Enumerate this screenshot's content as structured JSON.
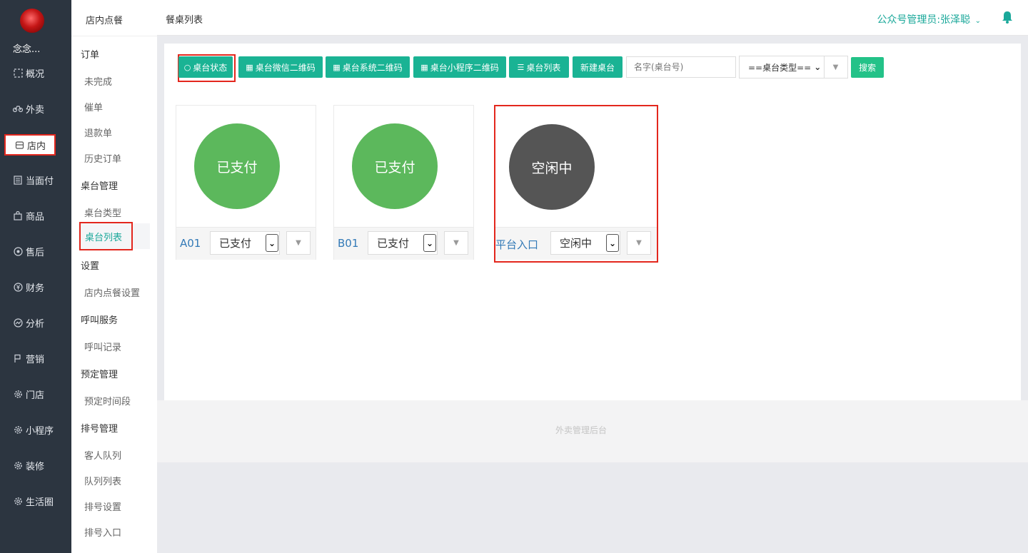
{
  "user": {
    "name": "念念..."
  },
  "nav": [
    {
      "label": "概况",
      "icon": "layout-icon"
    },
    {
      "label": "外卖",
      "icon": "bike-icon"
    },
    {
      "label": "店内",
      "icon": "store-icon",
      "active": true
    },
    {
      "label": "当面付",
      "icon": "receipt-icon"
    },
    {
      "label": "商品",
      "icon": "bag-icon"
    },
    {
      "label": "售后",
      "icon": "service-icon"
    },
    {
      "label": "财务",
      "icon": "yen-icon"
    },
    {
      "label": "分析",
      "icon": "chart-icon"
    },
    {
      "label": "营销",
      "icon": "flag-icon"
    },
    {
      "label": "门店",
      "icon": "gear-icon"
    },
    {
      "label": "小程序",
      "icon": "gear-icon"
    },
    {
      "label": "装修",
      "icon": "gear-icon"
    },
    {
      "label": "生活圈",
      "icon": "gear-icon"
    }
  ],
  "sidebar": {
    "title": "店内点餐",
    "groups": [
      {
        "label": "订单",
        "links": [
          "未完成",
          "催单",
          "退款单",
          "历史订单"
        ]
      },
      {
        "label": "桌台管理",
        "links": [
          "桌台类型",
          "桌台列表"
        ]
      },
      {
        "label": "设置",
        "links": [
          "店内点餐设置"
        ]
      },
      {
        "label": "呼叫服务",
        "links": [
          "呼叫记录"
        ]
      },
      {
        "label": "预定管理",
        "links": [
          "预定时间段"
        ]
      },
      {
        "label": "排号管理",
        "links": [
          "客人队列",
          "队列列表",
          "排号设置",
          "排号入口"
        ]
      }
    ],
    "active_link": "桌台列表"
  },
  "header": {
    "title": "餐桌列表",
    "admin": "公众号管理员:张泽聪",
    "admin_chevron": "chevron-down-icon",
    "bell": "bell-icon"
  },
  "toolbar": {
    "buttons": [
      "桌台状态",
      "桌台微信二维码",
      "桌台系统二维码",
      "桌台小程序二维码",
      "桌台列表",
      "新建桌台"
    ],
    "search_placeholder": "名字(桌台号)",
    "type_select": "==桌台类型==",
    "search_button": "搜索"
  },
  "tables": [
    {
      "name": "A01",
      "status": "已支付",
      "color": "#5cb85c"
    },
    {
      "name": "B01",
      "status": "已支付",
      "color": "#5cb85c"
    },
    {
      "name": "平台入口",
      "status": "空闲中",
      "color": "#555555"
    }
  ],
  "footer": "外卖管理后台",
  "colors": {
    "accent": "#1ab394",
    "highlight": "#e3271d",
    "nav_bg": "#2c3540"
  }
}
